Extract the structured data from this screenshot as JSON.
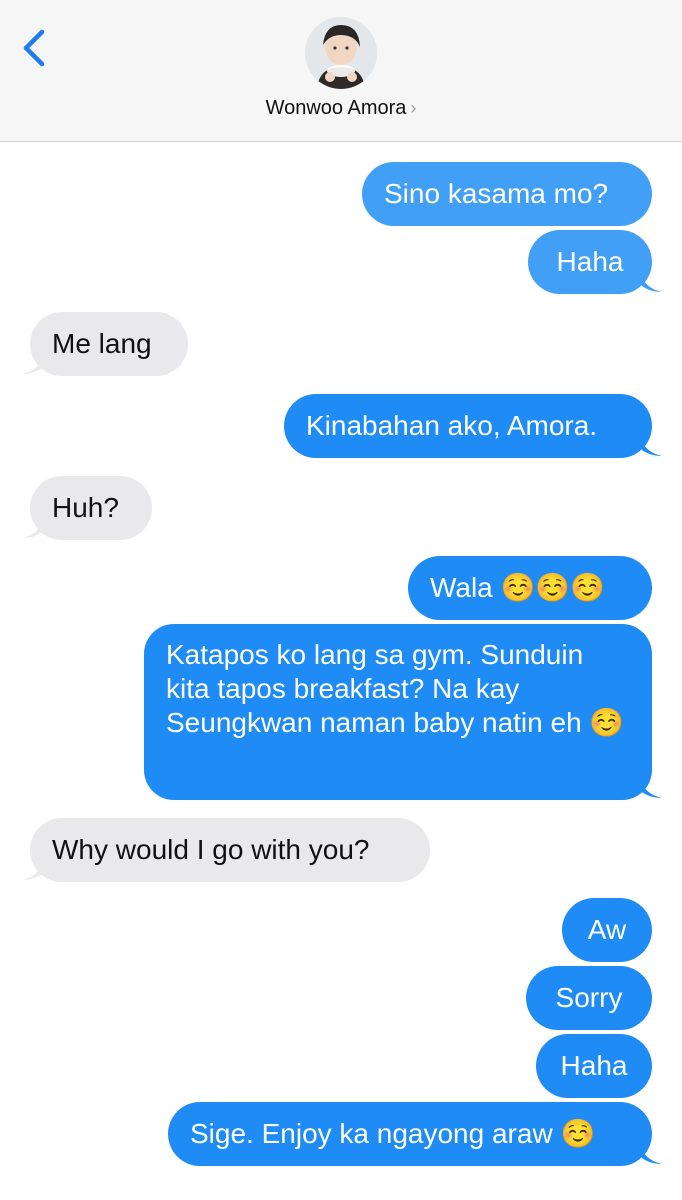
{
  "header": {
    "back_icon": "chevron-left-icon",
    "contact_name": "Wonwoo Amora",
    "contact_chevron": "›",
    "accent_color": "#1e7cf2"
  },
  "messages": [
    {
      "from": "me",
      "text": "Sino kasama mo?"
    },
    {
      "from": "me",
      "text": "Haha"
    },
    {
      "from": "them",
      "text": "Me lang"
    },
    {
      "from": "me",
      "text": "Kinabahan ako, Amora."
    },
    {
      "from": "them",
      "text": "Huh?"
    },
    {
      "from": "me",
      "text": "Wala ☺️☺️☺️"
    },
    {
      "from": "me",
      "text": "Katapos ko lang sa gym. Sunduin kita tapos breakfast? Na kay Seungkwan naman baby natin eh ☺️"
    },
    {
      "from": "them",
      "text": "Why would I go with you?"
    },
    {
      "from": "me",
      "text": "Aw"
    },
    {
      "from": "me",
      "text": "Sorry"
    },
    {
      "from": "me",
      "text": "Haha"
    },
    {
      "from": "me",
      "text": "Sige. Enjoy ka ngayong araw ☺️"
    }
  ],
  "colors": {
    "sent_bubble": "#1e8cf4",
    "received_bubble": "#e9e9eb"
  }
}
